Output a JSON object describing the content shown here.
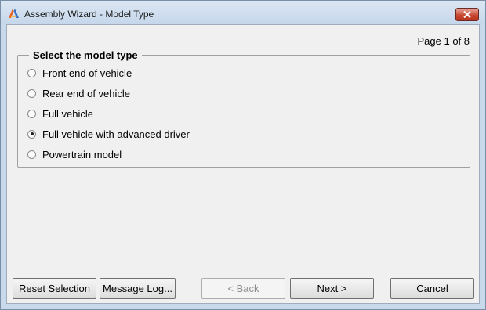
{
  "window": {
    "title": "Assembly Wizard - Model Type"
  },
  "page_indicator": "Page  1 of 8",
  "group": {
    "title": "Select the model type",
    "options": [
      {
        "label": "Front end of vehicle",
        "selected": false
      },
      {
        "label": "Rear end of vehicle",
        "selected": false
      },
      {
        "label": "Full vehicle",
        "selected": false
      },
      {
        "label": "Full vehicle with advanced driver",
        "selected": true
      },
      {
        "label": "Powertrain model",
        "selected": false
      }
    ]
  },
  "buttons": {
    "reset": "Reset Selection",
    "message_log": "Message Log...",
    "back": "< Back",
    "next": "Next >",
    "cancel": "Cancel"
  },
  "colors": {
    "close_button": "#c94a33",
    "titlebar": "#c9d9ec"
  }
}
